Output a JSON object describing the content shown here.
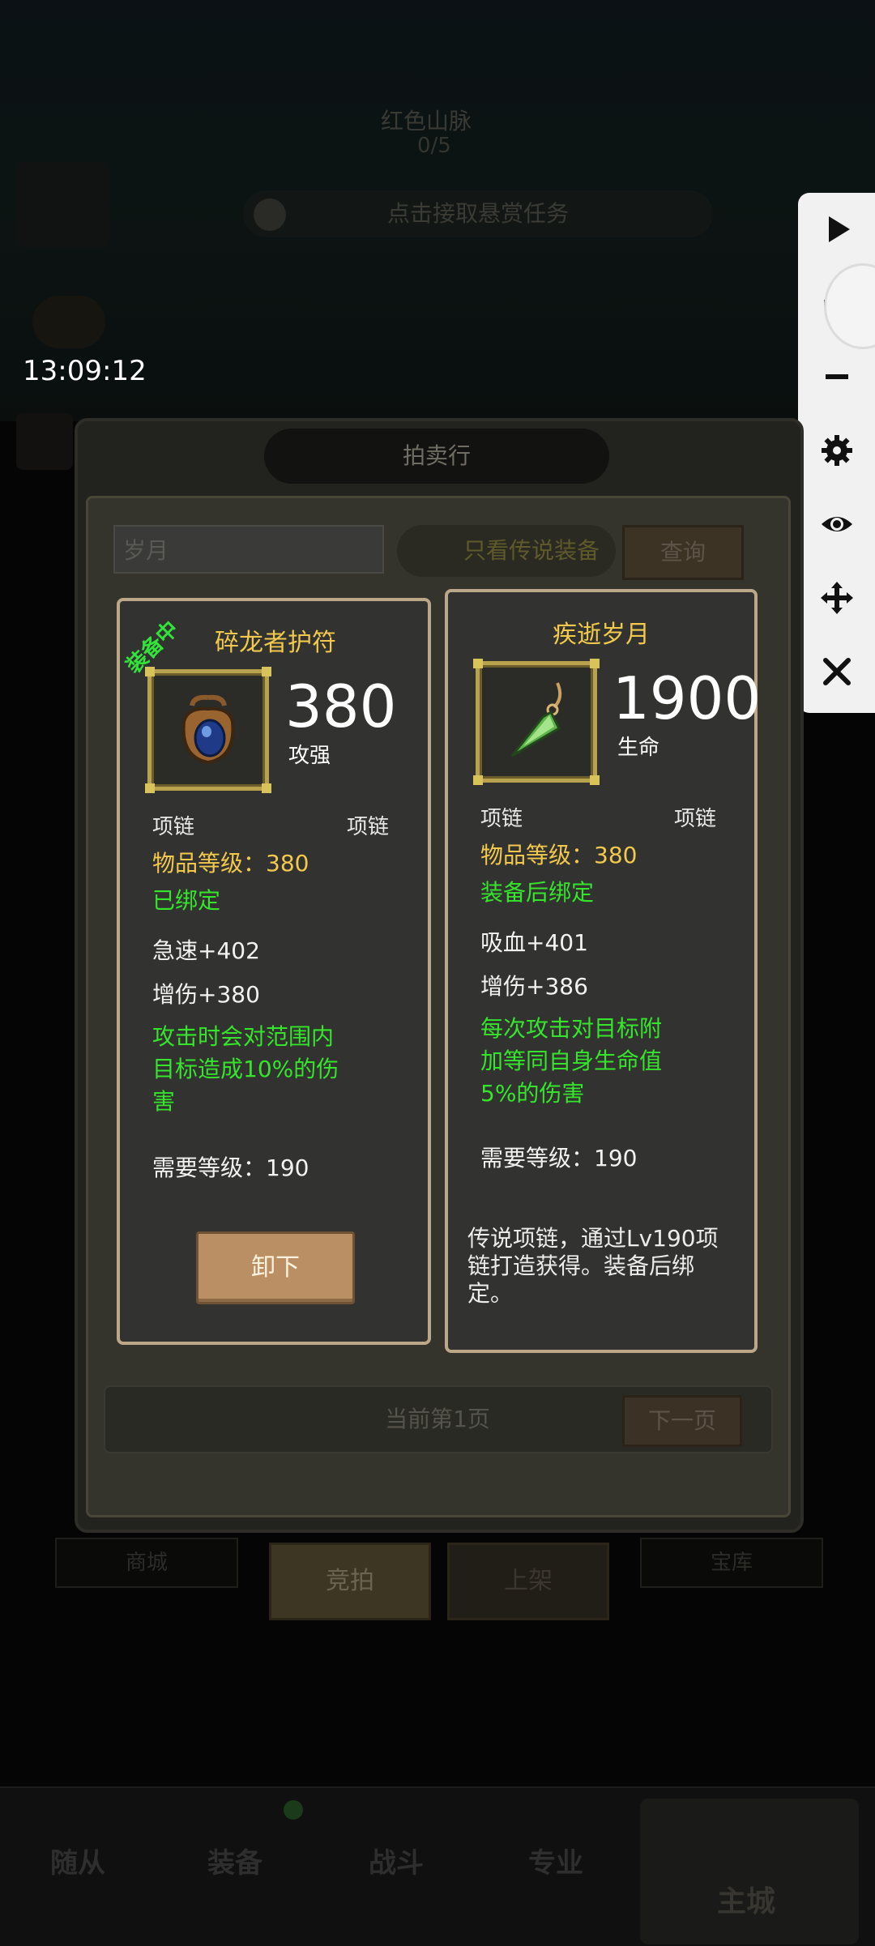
{
  "status": {
    "time": "13:09:12"
  },
  "background": {
    "quest_title": "红色山脉",
    "quest_count": "0/5",
    "quest_accept": "点击接取悬赏任务"
  },
  "panel": {
    "title": "拍卖行",
    "search_value": "岁月",
    "legend_toggle": "只看传说装备",
    "query_button": "查询",
    "page_label": "当前第1页",
    "next_button": "下一页"
  },
  "shop_tabs": [
    "商城",
    "竞拍",
    "上架",
    "宝库"
  ],
  "bottom_nav": [
    "随从",
    "装备",
    "战斗",
    "专业",
    "主城"
  ],
  "equipped_item": {
    "tag": "装备中",
    "name": "碎龙者护符",
    "value": "380",
    "value_label": "攻强",
    "slot_left": "项链",
    "slot_right": "项链",
    "item_level": "物品等级：380",
    "bind_status": "已绑定",
    "stats": [
      "急速+402",
      "增伤+380"
    ],
    "effect_lines": [
      "攻击时会对范围内",
      "目标造成10%的伤",
      "害"
    ],
    "required_level": "需要等级：190",
    "action_button": "卸下"
  },
  "compare_item": {
    "name": "疾逝岁月",
    "value": "1900",
    "value_label": "生命",
    "slot_left": "项链",
    "slot_right": "项链",
    "item_level": "物品等级：380",
    "bind_status": "装备后绑定",
    "stats": [
      "吸血+401",
      "增伤+386"
    ],
    "effect_lines": [
      "每次攻击对目标附",
      "加等同自身生命值",
      "5%的伤害"
    ],
    "required_level": "需要等级：190",
    "description_lines": [
      "传说项链，通过Lv190项",
      "链打造获得。装备后绑",
      "定。"
    ]
  },
  "toolbar_icons": [
    "play-icon",
    "zoom-in-icon",
    "zoom-out-icon",
    "gear-icon",
    "eye-icon",
    "move-icon",
    "close-icon"
  ],
  "colors": {
    "gold_text": "#f2c94c",
    "green_text": "#35e52c",
    "card_border": "#bca889"
  }
}
